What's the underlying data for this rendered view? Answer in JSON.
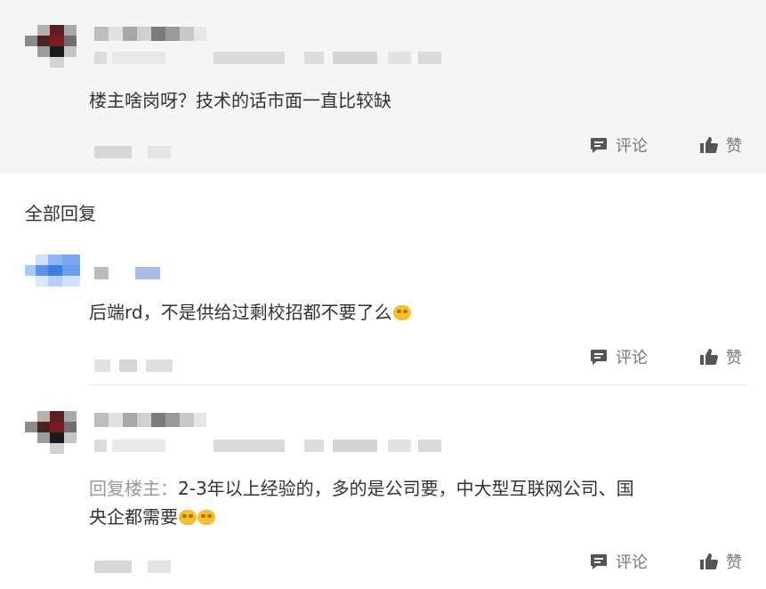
{
  "op_comment": {
    "text": "楼主啥岗呀？技术的话市面一直比较缺",
    "actions": {
      "comment_label": "评论",
      "like_label": "赞"
    }
  },
  "section": {
    "title": "全部回复"
  },
  "replies": [
    {
      "text": "后端rd，不是供给过剩校招都不要了么",
      "emoji": "smirk-emoji",
      "actions": {
        "comment_label": "评论",
        "like_label": "赞"
      }
    },
    {
      "reply_prefix": "回复楼主：",
      "text_line1": "2-3年以上经验的，多的是公司要，中大型互联网公司、国",
      "text_line2": "央企都需要",
      "emoji": "smile-emoji",
      "actions": {
        "comment_label": "评论",
        "like_label": "赞"
      }
    }
  ],
  "colors": {
    "op_background": "#f4f5f7",
    "text": "#333333",
    "muted_text": "#999999",
    "action_text": "#777777",
    "divider": "#ececec",
    "emoji": "#f4c02d"
  }
}
